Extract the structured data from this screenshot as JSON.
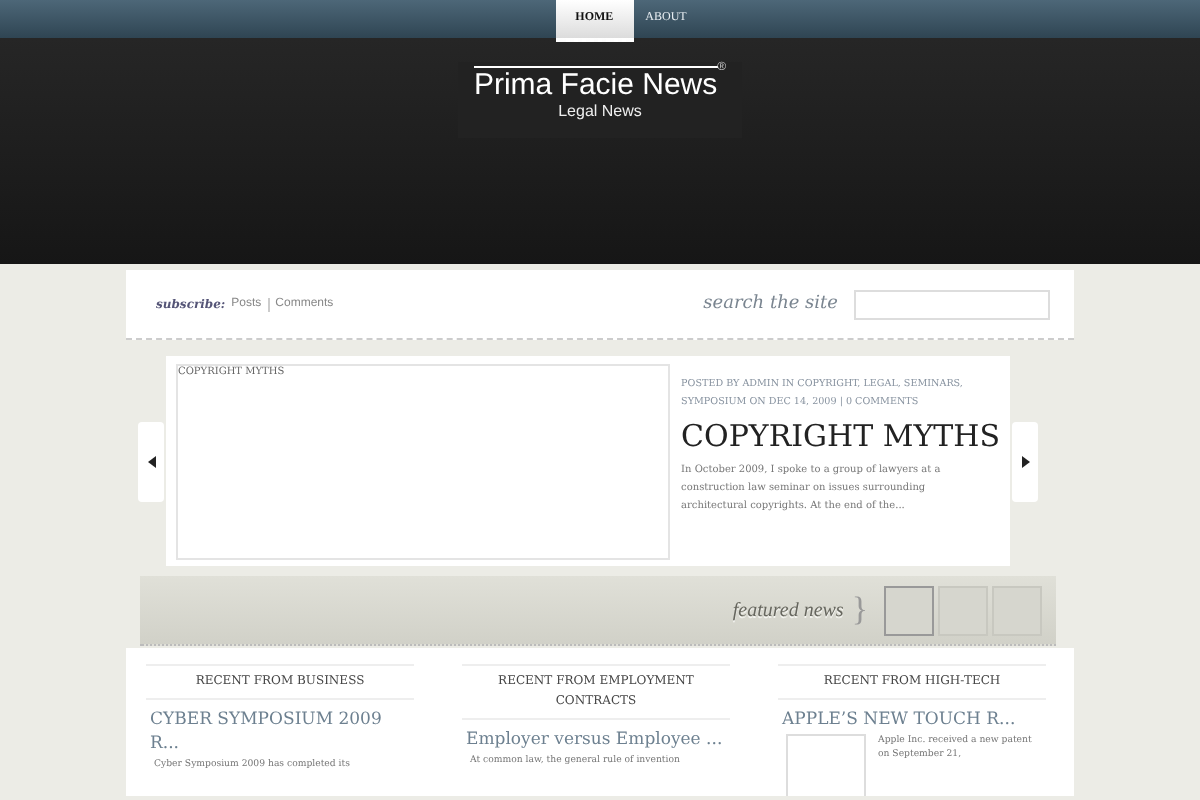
{
  "nav": [
    {
      "label": "HOME",
      "selected": true
    },
    {
      "label": "ABOUT",
      "selected": false
    }
  ],
  "site": {
    "title": "Prima Facie News",
    "mark": "®",
    "tagline": "Legal News"
  },
  "subscribe": {
    "label": "subscribe:",
    "links": [
      "Posts",
      "Comments"
    ]
  },
  "search": {
    "label": "search the site"
  },
  "slider": {
    "image_alt": "COPYRIGHT MYTHS",
    "meta": "POSTED BY ADMIN IN COPYRIGHT, LEGAL, SEMINARS, SYMPOSIUM ON DEC 14, 2009 | 0 COMMENTS",
    "title": "COPYRIGHT MYTHS",
    "excerpt": "In October 2009, I spoke to a group of lawyers at a construction law seminar on issues surrounding architectural copyrights.  At the end of the..."
  },
  "featured": {
    "label": "featured news",
    "brace": "}",
    "thumbs": [
      {
        "selected": true
      },
      {
        "selected": false
      },
      {
        "selected": false
      }
    ]
  },
  "columns": [
    {
      "heading": "RECENT FROM BUSINESS",
      "post_title": "CYBER SYMPOSIUM 2009 R...",
      "excerpt": "Cyber Symposium 2009 has completed its",
      "thumbnail": false
    },
    {
      "heading": "RECENT FROM EMPLOYMENT CONTRACTS",
      "post_title": "Employer versus Employee ...",
      "excerpt": "At common law, the general rule of invention",
      "thumbnail": false
    },
    {
      "heading": "RECENT FROM HIGH-TECH",
      "post_title": "APPLE’S NEW TOUCH R...",
      "excerpt": "Apple Inc. received a new patent on September 21,",
      "thumbnail": true
    }
  ]
}
